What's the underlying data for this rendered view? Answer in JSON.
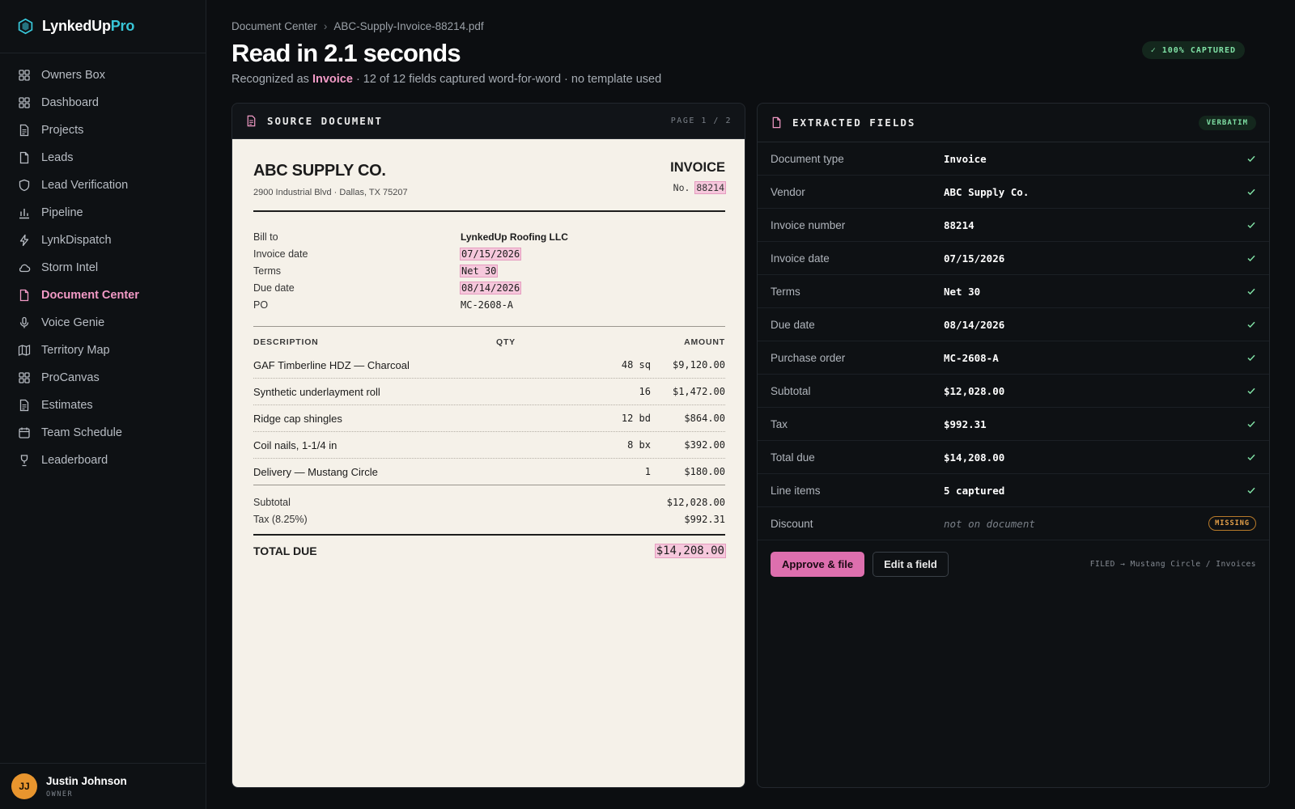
{
  "brand": {
    "name": "LynkedUp",
    "suffix": "Pro"
  },
  "sidebar": {
    "items": [
      {
        "label": "Owners Box",
        "icon": "grid-icon"
      },
      {
        "label": "Dashboard",
        "icon": "grid-icon"
      },
      {
        "label": "Projects",
        "icon": "document-icon"
      },
      {
        "label": "Leads",
        "icon": "file-icon"
      },
      {
        "label": "Lead Verification",
        "icon": "shield-icon"
      },
      {
        "label": "Pipeline",
        "icon": "bar-chart-icon"
      },
      {
        "label": "LynkDispatch",
        "icon": "bolt-icon"
      },
      {
        "label": "Storm Intel",
        "icon": "cloud-icon"
      },
      {
        "label": "Document Center",
        "icon": "file-icon",
        "active": true
      },
      {
        "label": "Voice Genie",
        "icon": "mic-icon"
      },
      {
        "label": "Territory Map",
        "icon": "map-icon"
      },
      {
        "label": "ProCanvas",
        "icon": "grid-icon"
      },
      {
        "label": "Estimates",
        "icon": "document-icon"
      },
      {
        "label": "Team Schedule",
        "icon": "calendar-icon"
      },
      {
        "label": "Leaderboard",
        "icon": "trophy-icon"
      }
    ]
  },
  "user": {
    "initials": "JJ",
    "name": "Justin Johnson",
    "role": "OWNER"
  },
  "breadcrumb": {
    "root": "Document Center",
    "separator": "›",
    "current": "ABC-Supply-Invoice-88214.pdf"
  },
  "header": {
    "title": "Read in 2.1 seconds",
    "subtitle_pre": "Recognized as ",
    "subtitle_type": "Invoice",
    "subtitle_post": " · 12 of 12 fields captured word-for-word · no template used",
    "badge": "✓ 100% CAPTURED"
  },
  "source": {
    "title": "SOURCE DOCUMENT",
    "page": "PAGE 1 / 2",
    "vendor": "ABC SUPPLY CO.",
    "vendor_address": "2900 Industrial Blvd · Dallas, TX 75207",
    "doc_label": "INVOICE",
    "no_label": "No.",
    "no_value": "88214",
    "meta": [
      {
        "k": "Bill to",
        "v": "LynkedUp Roofing LLC",
        "style": "bold"
      },
      {
        "k": "Invoice date",
        "v": "07/15/2026",
        "style": "mark"
      },
      {
        "k": "Terms",
        "v": "Net 30",
        "style": "mark"
      },
      {
        "k": "Due date",
        "v": "08/14/2026",
        "style": "mark"
      },
      {
        "k": "PO",
        "v": "MC-2608-A",
        "style": "mono"
      }
    ],
    "columns": {
      "description": "DESCRIPTION",
      "qty": "QTY",
      "amount": "AMOUNT"
    },
    "items": [
      {
        "description": "GAF Timberline HDZ — Charcoal",
        "qty": "48 sq",
        "amount": "$9,120.00"
      },
      {
        "description": "Synthetic underlayment roll",
        "qty": "16",
        "amount": "$1,472.00"
      },
      {
        "description": "Ridge cap shingles",
        "qty": "12 bd",
        "amount": "$864.00"
      },
      {
        "description": "Coil nails, 1-1/4 in",
        "qty": "8 bx",
        "amount": "$392.00"
      },
      {
        "description": "Delivery — Mustang Circle",
        "qty": "1",
        "amount": "$180.00"
      }
    ],
    "subtotal_label": "Subtotal",
    "subtotal": "$12,028.00",
    "tax_label": "Tax (8.25%)",
    "tax": "$992.31",
    "total_label": "TOTAL DUE",
    "total": "$14,208.00"
  },
  "extracted": {
    "title": "EXTRACTED FIELDS",
    "badge": "VERBATIM",
    "fields": [
      {
        "k": "Document type",
        "v": "Invoice",
        "status": "ok"
      },
      {
        "k": "Vendor",
        "v": "ABC Supply Co.",
        "status": "ok"
      },
      {
        "k": "Invoice number",
        "v": "88214",
        "status": "ok"
      },
      {
        "k": "Invoice date",
        "v": "07/15/2026",
        "status": "ok"
      },
      {
        "k": "Terms",
        "v": "Net 30",
        "status": "ok"
      },
      {
        "k": "Due date",
        "v": "08/14/2026",
        "status": "ok"
      },
      {
        "k": "Purchase order",
        "v": "MC-2608-A",
        "status": "ok"
      },
      {
        "k": "Subtotal",
        "v": "$12,028.00",
        "status": "ok"
      },
      {
        "k": "Tax",
        "v": "$992.31",
        "status": "ok"
      },
      {
        "k": "Total due",
        "v": "$14,208.00",
        "status": "ok"
      },
      {
        "k": "Line items",
        "v": "5 captured",
        "status": "ok"
      },
      {
        "k": "Discount",
        "v": "not on document",
        "status": "missing",
        "badge": "MISSING"
      }
    ],
    "approve_label": "Approve & file",
    "edit_label": "Edit a field",
    "filed_note": "FILED → Mustang Circle / Invoices"
  },
  "colors": {
    "accent": "#f29ac6",
    "brand": "#38c6d8",
    "success": "#7fe0a4",
    "warning": "#e7a24a"
  }
}
